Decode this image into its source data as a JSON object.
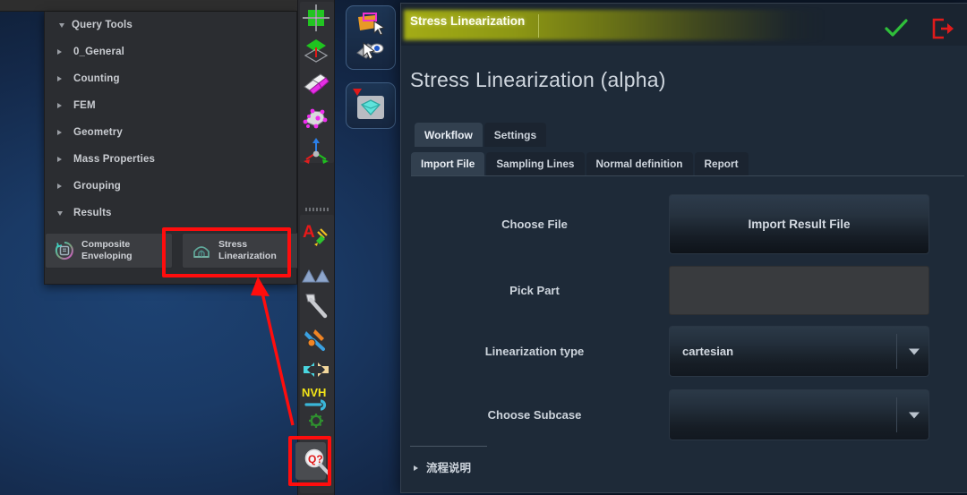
{
  "background": {
    "name": "3d-viewport",
    "color": "#1a3a66"
  },
  "tree_panel": {
    "root": {
      "label": "Query Tools",
      "expanded": true
    },
    "items": [
      {
        "label": "0_General",
        "expanded": false
      },
      {
        "label": "Counting",
        "expanded": false
      },
      {
        "label": "FEM",
        "expanded": false
      },
      {
        "label": "Geometry",
        "expanded": false
      },
      {
        "label": "Mass Properties",
        "expanded": false
      },
      {
        "label": "Grouping",
        "expanded": false
      },
      {
        "label": "Results",
        "expanded": true
      }
    ],
    "results_items": [
      {
        "label_line1": "Composite",
        "label_line2": "Enveloping",
        "icon": "composite-enveloping-icon"
      },
      {
        "label_line1": "Stress",
        "label_line2": "Linearization",
        "icon": "stress-linearization-icon"
      }
    ]
  },
  "annotations": {
    "highlight_color": "#ff0d0d",
    "boxes": [
      "stress-linearization-menu-item",
      "query-tools-toolbar-icon"
    ],
    "arrow": "points-from-toolbar-icon-to-menu-item"
  },
  "toolbar": {
    "icons": [
      "move-grid-icon",
      "plane-icon",
      "surfaces-icon",
      "nodes-icon",
      "axis-triad-icon",
      "annotation-text-icon",
      "mountains-icon",
      "hammer-icon",
      "wrench-tools-icon",
      "swap-arrows-icon",
      "nvh-icon",
      "gear-icon",
      "query-tools-icon"
    ],
    "active_icon": "query-tools-icon"
  },
  "ribbon_tabs": [
    {
      "name": "selection-tab",
      "icons": [
        "orange-plate-cursor-icon",
        "mask-eye-cursor-icon"
      ]
    },
    {
      "name": "visualization-tab",
      "icons": [
        "teal-gem-icon"
      ]
    }
  ],
  "dialog": {
    "titlebar": {
      "title": "Stress Linearization",
      "accept_icon": "check-icon",
      "close_icon": "exit-icon",
      "glow_color": "#a9b215",
      "accept_color": "#2fbf3a",
      "close_color": "#e01b1b"
    },
    "heading": "Stress Linearization (alpha)",
    "main_tabs": [
      {
        "label": "Workflow",
        "active": true
      },
      {
        "label": "Settings",
        "active": false
      }
    ],
    "sub_tabs": [
      {
        "label": "Import File",
        "active": true
      },
      {
        "label": "Sampling Lines",
        "active": false
      },
      {
        "label": "Normal definition",
        "active": false
      },
      {
        "label": "Report",
        "active": false
      }
    ],
    "form": [
      {
        "label": "Choose File",
        "control": "button",
        "value": "Import Result File"
      },
      {
        "label": "Pick Part",
        "control": "field",
        "value": ""
      },
      {
        "label": "Linearization type",
        "control": "dropdown",
        "value": "cartesian"
      },
      {
        "label": "Choose Subcase",
        "control": "dropdown",
        "value": ""
      }
    ],
    "footer": {
      "label": "流程说明",
      "expanded": false
    }
  }
}
